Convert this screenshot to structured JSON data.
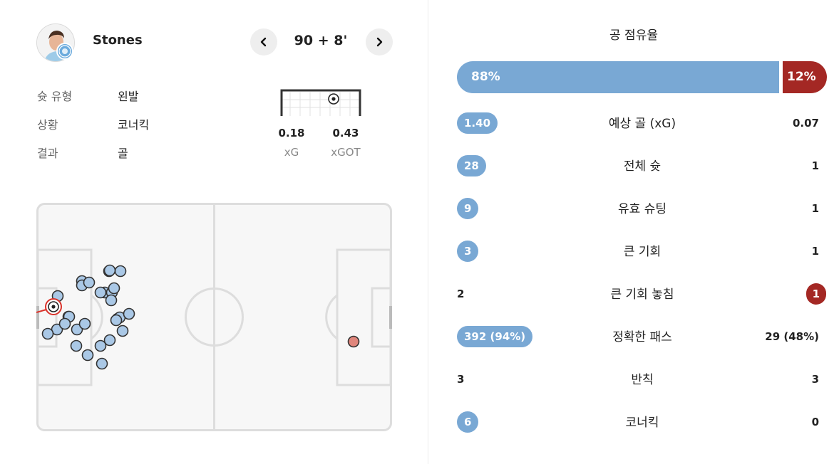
{
  "player": {
    "name": "Stones"
  },
  "match_minute": "90 + 8'",
  "shot_info": [
    {
      "label": "슛 유형",
      "value": "왼발"
    },
    {
      "label": "상황",
      "value": "코너킥"
    },
    {
      "label": "결과",
      "value": "골"
    }
  ],
  "xg": {
    "xg_value": "0.18",
    "xg_label": "xG",
    "xgot_value": "0.43",
    "xgot_label": "xGOT"
  },
  "colors": {
    "home": "#79a8d4",
    "away": "#a42824",
    "shot_fill": "#aac8e6",
    "away_shot": "#e0867c"
  },
  "icons": {
    "prev": "chevron-left-icon",
    "next": "chevron-right-icon",
    "ball": "soccer-ball-icon"
  },
  "possession": {
    "title": "공 점유율",
    "home": "88%",
    "away": "12%",
    "home_fraction": 0.88
  },
  "stats": [
    {
      "label": "예상 골 (xG)",
      "home": "1.40",
      "away": "0.07",
      "home_highlight": true,
      "away_highlight": false
    },
    {
      "label": "전체 슛",
      "home": "28",
      "away": "1",
      "home_highlight": true,
      "away_highlight": false
    },
    {
      "label": "유효 슈팅",
      "home": "9",
      "away": "1",
      "home_highlight": true,
      "away_highlight": false
    },
    {
      "label": "큰 기회",
      "home": "3",
      "away": "1",
      "home_highlight": true,
      "away_highlight": false
    },
    {
      "label": "큰 기회 놓침",
      "home": "2",
      "away": "1",
      "home_highlight": false,
      "away_highlight": true
    },
    {
      "label": "정확한 패스",
      "home": "392 (94%)",
      "away": "29 (48%)",
      "home_highlight": true,
      "away_highlight": false
    },
    {
      "label": "반칙",
      "home": "3",
      "away": "3",
      "home_highlight": false,
      "away_highlight": false
    },
    {
      "label": "코너킥",
      "home": "6",
      "away": "0",
      "home_highlight": true,
      "away_highlight": false
    }
  ]
}
